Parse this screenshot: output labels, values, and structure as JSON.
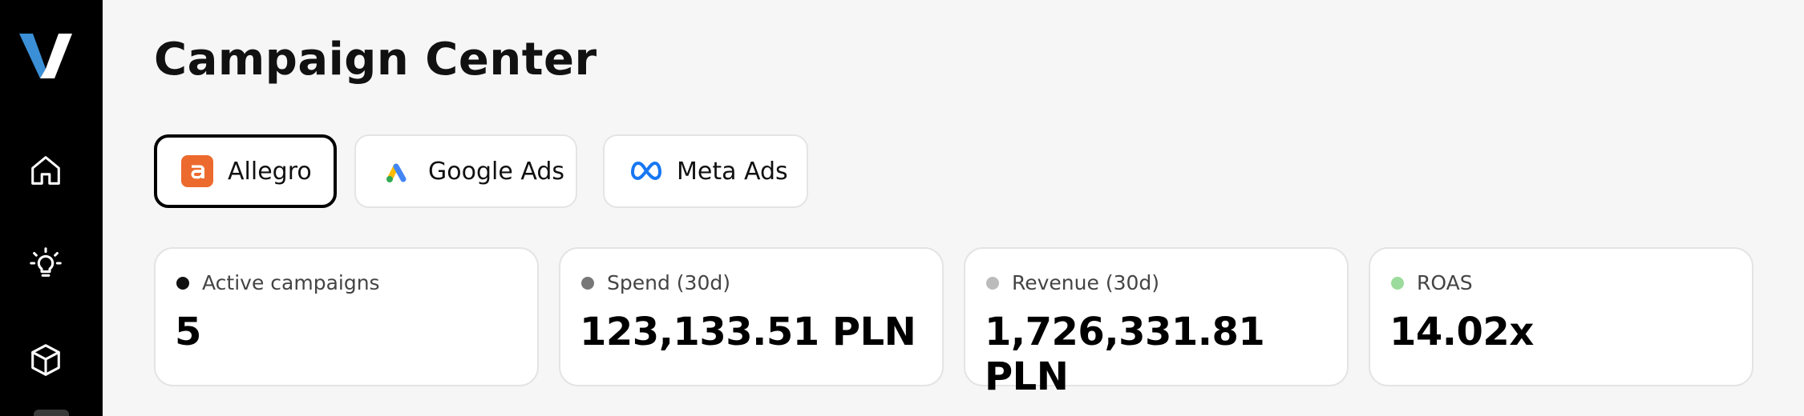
{
  "sidebar": {
    "logo": "V",
    "items": [
      {
        "icon": "home-icon"
      },
      {
        "icon": "lightbulb-icon"
      },
      {
        "icon": "cube-icon"
      }
    ]
  },
  "main": {
    "title": "Campaign Center",
    "tabs": [
      {
        "label": "Allegro",
        "icon": "allegro-icon",
        "active": true,
        "color": "#ff5a00"
      },
      {
        "label": "Google Ads",
        "icon": "google-ads-icon",
        "active": false
      },
      {
        "label": "Meta Ads",
        "icon": "meta-icon",
        "active": false,
        "color": "#0668e1"
      }
    ],
    "stats": [
      {
        "label": "Active campaigns",
        "value": "5",
        "dot_color": "#111111"
      },
      {
        "label": "Spend (30d)",
        "value": "123,133.51 PLN",
        "dot_color": "#777777"
      },
      {
        "label": "Revenue (30d)",
        "value": "1,726,331.81 PLN",
        "dot_color": "#bbbbbb"
      },
      {
        "label": "ROAS",
        "value": "14.02x",
        "dot_color": "#9bdb9b"
      }
    ]
  },
  "colors": {
    "sidebar_bg": "#000000",
    "page_bg": "#f6f6f6",
    "logo_light": "#ffffff",
    "logo_accent": "#3b8fd6"
  }
}
